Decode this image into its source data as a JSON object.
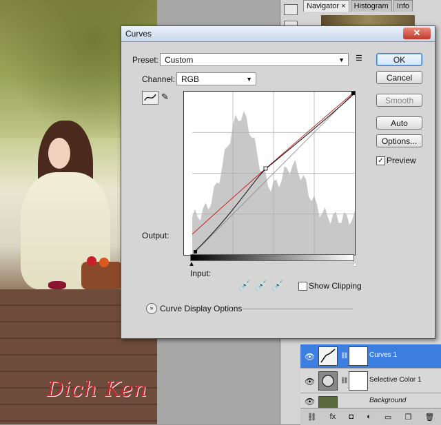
{
  "navigator_panel": {
    "tabs": [
      "Navigator ×",
      "Histogram",
      "Info"
    ]
  },
  "layers_panel": {
    "layers": [
      {
        "name": "Curves 1",
        "selected": true
      },
      {
        "name": "Selective Color 1",
        "selected": false
      },
      {
        "name": "Background",
        "selected": false
      }
    ],
    "footer_icons": [
      "link-icon",
      "fx-icon",
      "mask-icon",
      "adjustment-icon",
      "group-icon",
      "new-layer-icon",
      "trash-icon"
    ]
  },
  "photo": {
    "signature": "Dich Ken"
  },
  "curves_dialog": {
    "title": "Curves",
    "close_label": "✕",
    "preset_label": "Preset:",
    "preset_value": "Custom",
    "channel_label": "Channel:",
    "channel_value": "RGB",
    "output_label": "Output:",
    "input_label": "Input:",
    "show_clipping_label": "Show Clipping",
    "show_clipping_checked": false,
    "curve_display_options_label": "Curve Display Options",
    "buttons": {
      "ok": "OK",
      "cancel": "Cancel",
      "smooth": "Smooth",
      "auto": "Auto",
      "options": "Options..."
    },
    "preview_label": "Preview",
    "preview_checked": true,
    "colors": {
      "curve_main": "#1a1a1a",
      "curve_red": "#cc2222",
      "histogram": "#c8c8c8",
      "ok_accent": "#3a7bd5",
      "selected_layer": "#3d7fe0"
    }
  }
}
